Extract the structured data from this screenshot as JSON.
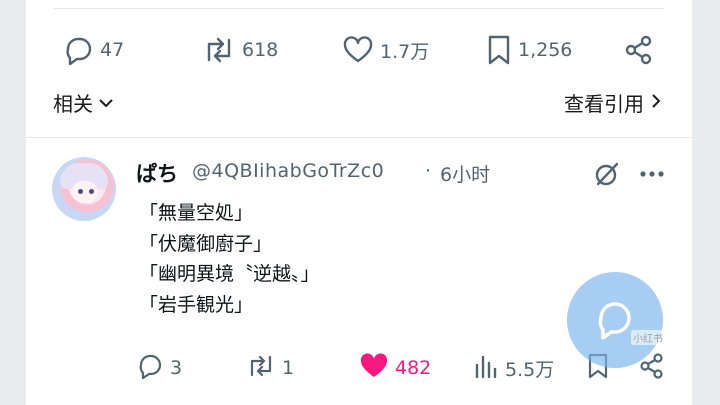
{
  "top_tweet": {
    "replies": "47",
    "reposts": "618",
    "likes": "1.7万",
    "bookmarks": "1,256",
    "related_label": "相关",
    "quotes_label": "查看引用"
  },
  "reply": {
    "display_name": "ぱち",
    "handle": "@4QBIihabGoTrZc0",
    "separator": "·",
    "time": "6小时",
    "lines": [
      "「無量空処」",
      "「伏魔御廚子」",
      "「幽明異境〝逆越〟」",
      "「岩手観光」"
    ],
    "stats": {
      "replies": "3",
      "reposts": "1",
      "likes": "482",
      "views": "5.5万"
    }
  },
  "watermark": "小红书",
  "colors": {
    "text": "#0f1419",
    "muted": "#536471",
    "like": "#f91880",
    "fab": "#78b4eb"
  },
  "icons": [
    "reply-icon",
    "repost-icon",
    "like-icon",
    "bookmark-icon",
    "share-icon",
    "chevron-down-icon",
    "chevron-right-icon",
    "grok-icon",
    "more-icon",
    "views-icon",
    "chat-fab-icon"
  ]
}
